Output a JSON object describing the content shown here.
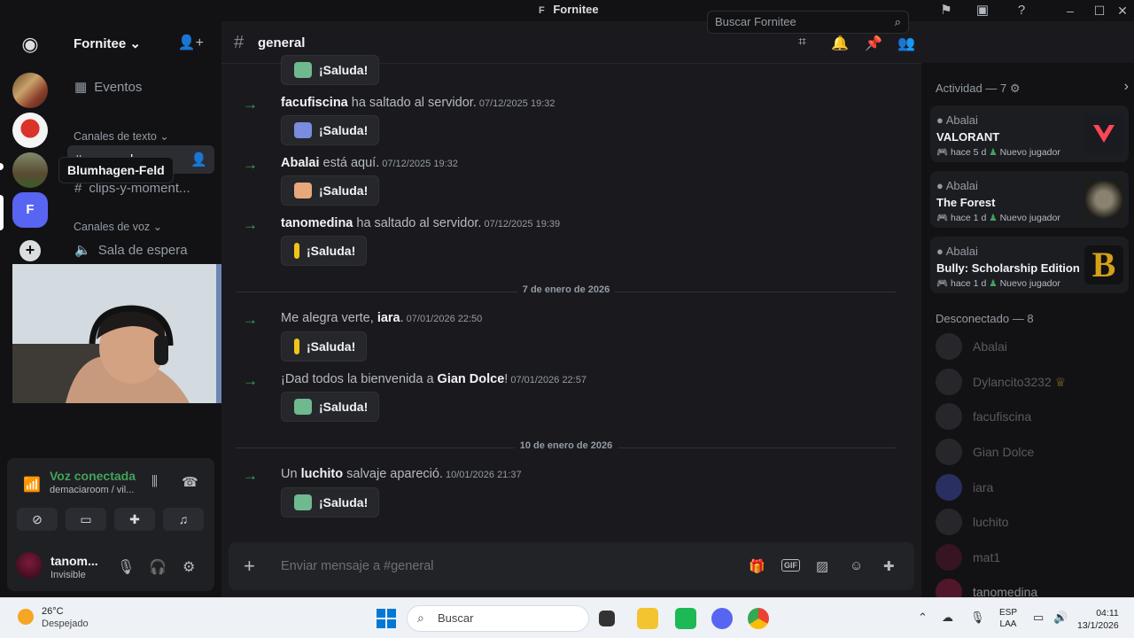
{
  "window": {
    "title": "Fornitee",
    "title_initial": "F"
  },
  "server": {
    "name": "Fornitee"
  },
  "guild_tooltip": "Blumhagen-Feld",
  "guild_f_label": "F",
  "sidebar": {
    "events_label": "Eventos",
    "text_category": "Canales de texto",
    "text_channels": [
      "general",
      "clips-y-moment..."
    ],
    "voice_category": "Canales de voz",
    "voice_channels": [
      "Sala de espera"
    ]
  },
  "voice": {
    "status": "Voz conectada",
    "location": "demaciaroom / vil..."
  },
  "user": {
    "name": "tanom...",
    "status": "Invisible"
  },
  "channel": {
    "name": "general"
  },
  "search": {
    "placeholder": "Buscar Fornitee"
  },
  "messages": [
    {
      "pre": "",
      "name": "facufiscina",
      "post": " ha saltado al servidor.",
      "ts": "07/12/2025 19:32",
      "wave": "¡Saluda!",
      "sticker": "#7b8cde"
    },
    {
      "pre": "",
      "name": "Abalai",
      "post": " está aquí.",
      "ts": "07/12/2025 19:32",
      "wave": "¡Saluda!",
      "sticker": "#e8a87c"
    },
    {
      "pre": "",
      "name": "tanomedina",
      "post": " ha saltado al servidor.",
      "ts": "07/12/2025 19:39",
      "wave": "¡Saluda!",
      "sticker": "#f0c419"
    },
    {
      "pre": "Me alegra verte, ",
      "name": "iara",
      "post": ".",
      "ts": "07/01/2026 22:50",
      "wave": "¡Saluda!",
      "sticker": "#f0c419"
    },
    {
      "pre": "¡Dad todos la bienvenida a ",
      "name": "Gian Dolce",
      "post": "!",
      "ts": "07/01/2026 22:57",
      "wave": "¡Saluda!",
      "sticker": "#6fb98f"
    },
    {
      "pre": "Un ",
      "name": "luchito",
      "post": " salvaje apareció.",
      "ts": "10/01/2026 21:37",
      "wave": "¡Saluda!",
      "sticker": "#6fb98f"
    }
  ],
  "top_wave": "¡Saluda!",
  "dividers": [
    "7 de enero de 2026",
    "10 de enero de 2026"
  ],
  "composer": {
    "placeholder": "Enviar mensaje a #general",
    "gif": "GIF"
  },
  "members": {
    "activity_header": "Actividad — 7",
    "activities": [
      {
        "user": "Abalai",
        "game": "VALORANT",
        "time": "hace 5 d",
        "badge": "Nuevo jugador"
      },
      {
        "user": "Abalai",
        "game": "The Forest",
        "time": "hace 1 d",
        "badge": "Nuevo jugador"
      },
      {
        "user": "Abalai",
        "game": "Bully: Scholarship Edition",
        "time": "hace 1 d",
        "badge": "Nuevo jugador"
      }
    ],
    "offline_header": "Desconectado — 8",
    "offline": [
      "Abalai",
      "Dylancito3232",
      "facufiscina",
      "Gian Dolce",
      "iara",
      "luchito",
      "mat1",
      "tanomedina"
    ]
  },
  "taskbar": {
    "temp": "26°C",
    "weather": "Despejado",
    "search": "Buscar",
    "lang1": "ESP",
    "lang2": "LAA",
    "time": "04:11",
    "date": "13/1/2026"
  },
  "colors": {
    "accent": "#5865f2",
    "green": "#43a25a",
    "bg": "#1a1a1e"
  }
}
